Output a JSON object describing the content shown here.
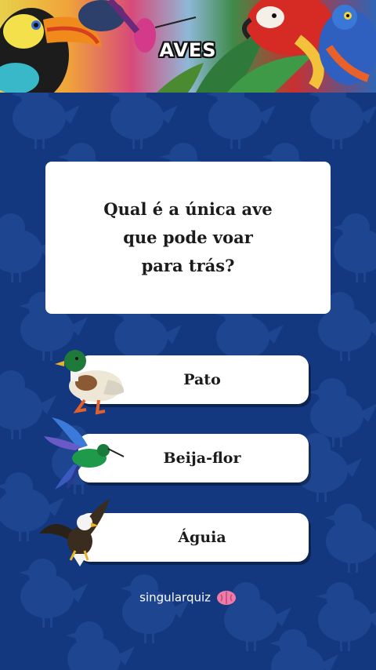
{
  "header": {
    "title": "AVES"
  },
  "question": {
    "text": "Qual é a única ave que pode voar para trás?"
  },
  "answers": [
    {
      "label": "Pato",
      "icon": "duck-icon"
    },
    {
      "label": "Beija-flor",
      "icon": "hummingbird-icon"
    },
    {
      "label": "Águia",
      "icon": "eagle-icon"
    }
  ],
  "footer": {
    "brand": "singularquiz",
    "icon": "brain-icon"
  },
  "colors": {
    "background": "#13387f",
    "card": "#ffffff",
    "text": "#1b1b1b"
  }
}
